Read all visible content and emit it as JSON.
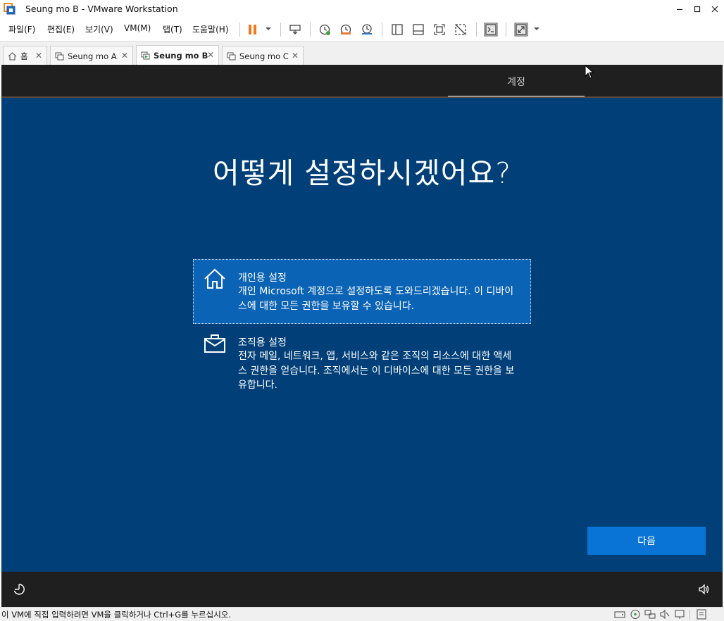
{
  "window": {
    "title": "Seung mo B - VMware Workstation",
    "minimize": "−",
    "maximize": "□",
    "close": "✕"
  },
  "menu": {
    "items": [
      "파일(F)",
      "편집(E)",
      "보기(V)",
      "VM(M)",
      "탭(T)",
      "도움말(H)"
    ]
  },
  "tabs": [
    {
      "label": "홈",
      "active": false
    },
    {
      "label": "Seung mo A",
      "active": false
    },
    {
      "label": "Seung mo B",
      "active": true
    },
    {
      "label": "Seung mo C",
      "active": false
    }
  ],
  "vm": {
    "step_tab": "계정",
    "headline": "어떻게 설정하시겠어요?",
    "options": [
      {
        "title": "개인용 설정",
        "description": "개인 Microsoft 계정으로 설정하도록 도와드리겠습니다. 이 디바이스에 대한 모든 권한을 보유할 수 있습니다.",
        "icon": "home-icon",
        "selected": true
      },
      {
        "title": "조직용 설정",
        "description": "전자 메일, 네트워크, 앱, 서비스와 같은 조직의 리소스에 대한 액세스 권한을 얻습니다. 조직에서는 이 디바이스에 대한 모든 권한을 보유합니다.",
        "icon": "briefcase-icon",
        "selected": false
      }
    ],
    "next_button": "다음"
  },
  "status": {
    "message": "이 VM에 직접 입력하려면 VM을 클릭하거나 Ctrl+G를 누르십시오."
  },
  "colors": {
    "vm_background": "#003f78",
    "selected_option": "#0a63b5",
    "next_button": "#0a74d6",
    "pause_icon": "#f07a1e"
  }
}
